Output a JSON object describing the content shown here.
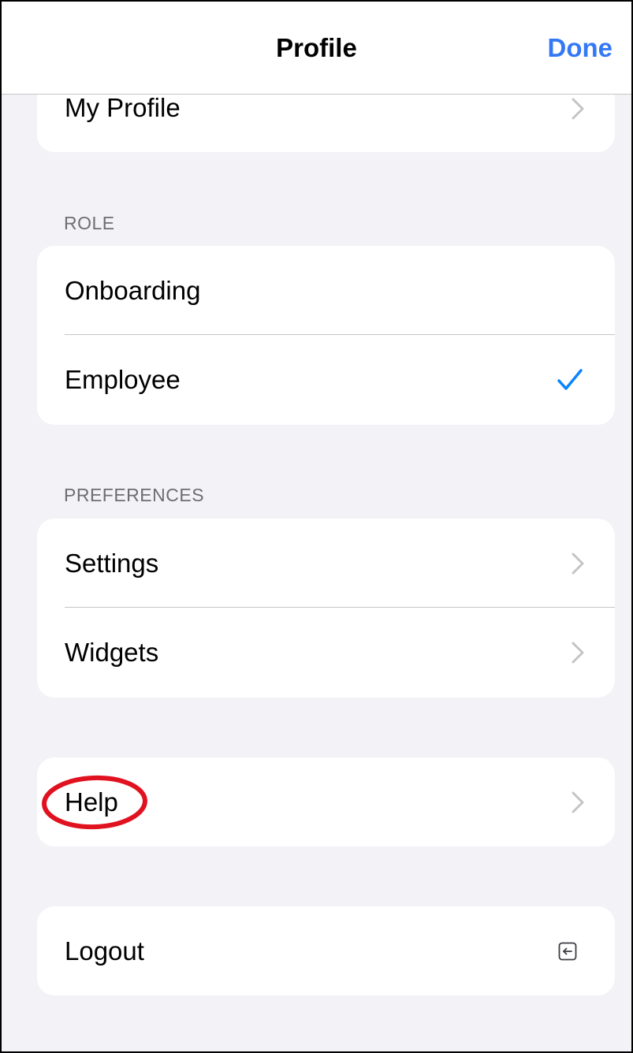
{
  "navbar": {
    "title": "Profile",
    "done_label": "Done"
  },
  "profile_section": {
    "items": [
      {
        "label": "My Profile",
        "accessory": "chevron-right-icon"
      }
    ]
  },
  "role_section": {
    "header": "ROLE",
    "items": [
      {
        "label": "Onboarding",
        "selected": false
      },
      {
        "label": "Employee",
        "selected": true,
        "accessory": "checkmark-icon"
      }
    ]
  },
  "preferences_section": {
    "header": "PREFERENCES",
    "items": [
      {
        "label": "Settings",
        "accessory": "chevron-right-icon"
      },
      {
        "label": "Widgets",
        "accessory": "chevron-right-icon"
      }
    ]
  },
  "help_section": {
    "items": [
      {
        "label": "Help",
        "accessory": "chevron-right-icon",
        "annotated": true
      }
    ]
  },
  "logout_section": {
    "items": [
      {
        "label": "Logout",
        "accessory": "logout-icon"
      }
    ]
  },
  "colors": {
    "accent": "#3478f6",
    "checkmark": "#0a84ff",
    "background": "#f2f2f7",
    "card": "#ffffff",
    "separator": "#c6c6c8",
    "secondary_text": "#6d6d72",
    "chevron": "#c4c4c7",
    "annotation": "#e0121f"
  }
}
